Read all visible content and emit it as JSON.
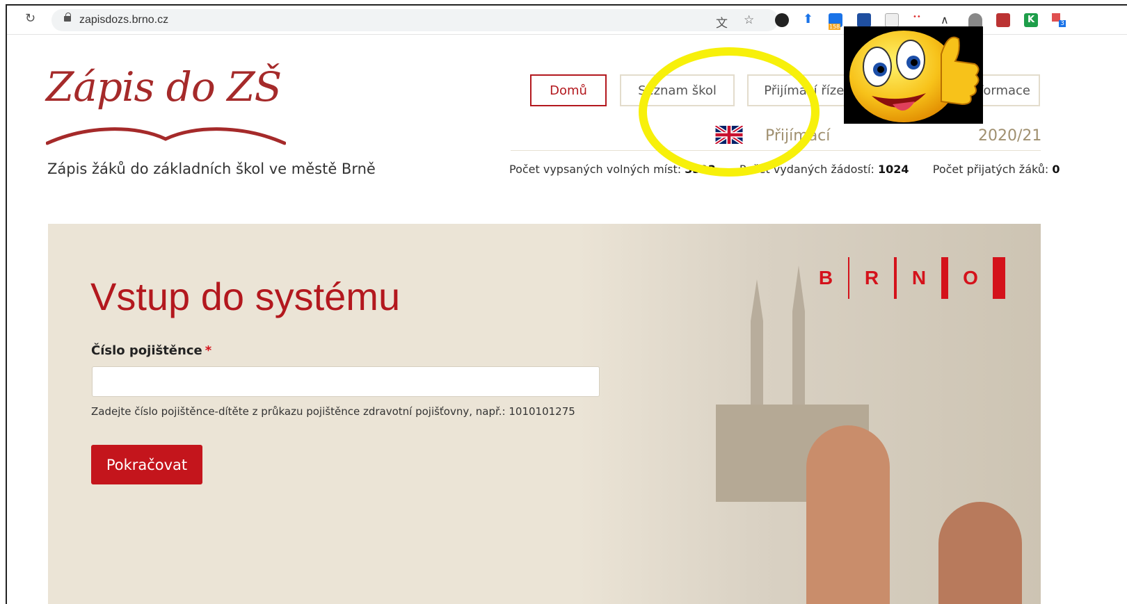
{
  "browser": {
    "url": "zapisdozs.brno.cz",
    "extension_badge": "158",
    "extension_badge_2": "3",
    "extension_k": "K"
  },
  "header": {
    "logo_text": "Zápis do ZŠ",
    "subtitle": "Zápis žáků do základních škol ve městě Brně",
    "nav": [
      "Domů",
      "Seznam škol",
      "Přijímací řízení",
      "Informace"
    ],
    "prijimaci": "Přijímací",
    "year": "2020/21",
    "stats": {
      "free_label": "Počet vypsaných volných míst:",
      "free_value": "3393",
      "issued_label": "Počet vydaných žádostí:",
      "issued_value": "1024",
      "accepted_label": "Počet přijatých žáků:",
      "accepted_value": "0"
    }
  },
  "hero": {
    "brand": [
      "B",
      "R",
      "N",
      "O"
    ],
    "title": "Vstup do systému",
    "field_label": "Číslo pojištěnce",
    "required_mark": "*",
    "field_value": "",
    "hint": "Zadejte číslo pojištěnce-dítěte z průkazu pojištěnce zdravotní pojišťovny, např.: 1010101275",
    "continue_label": "Pokračovat"
  },
  "colors": {
    "accent": "#b3181e",
    "brno_red": "#d4121b",
    "hero_bg": "#ebe4d6",
    "highlight": "#f7f00a"
  }
}
